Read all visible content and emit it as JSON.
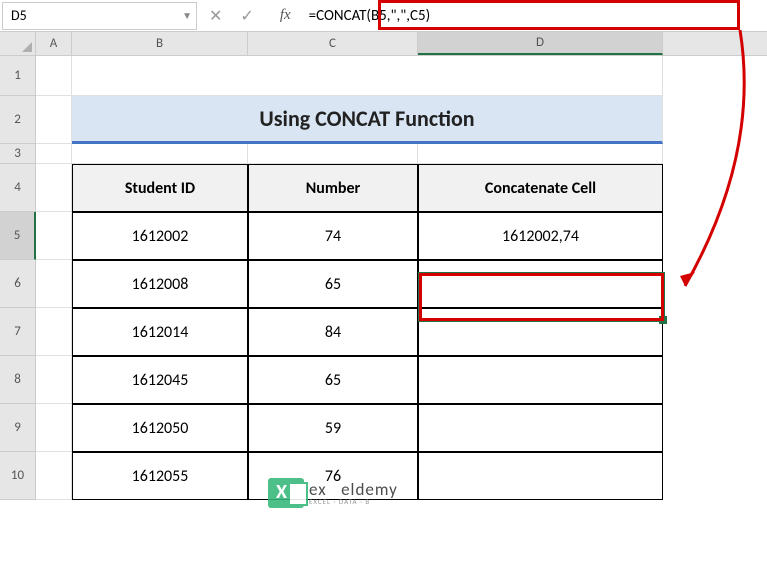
{
  "name_box": "D5",
  "formula_bar": "=CONCAT(B5,\",\",C5)",
  "columns": [
    "A",
    "B",
    "C",
    "D"
  ],
  "rows": [
    "1",
    "2",
    "3",
    "4",
    "5",
    "6",
    "7",
    "8",
    "9",
    "10"
  ],
  "active_row": "5",
  "active_col": "D",
  "title": "Using CONCAT Function",
  "table": {
    "headers": [
      "Student ID",
      "Number",
      "Concatenate Cell"
    ],
    "rows": [
      {
        "id": "1612002",
        "num": "74",
        "concat": "1612002,74"
      },
      {
        "id": "1612008",
        "num": "65",
        "concat": ""
      },
      {
        "id": "1612014",
        "num": "84",
        "concat": ""
      },
      {
        "id": "1612045",
        "num": "65",
        "concat": ""
      },
      {
        "id": "1612050",
        "num": "59",
        "concat": ""
      },
      {
        "id": "1612055",
        "num": "76",
        "concat": ""
      }
    ]
  },
  "logo": {
    "main": "ex   eldemy",
    "sub": "EXCEL · DATA · B"
  },
  "chart_data": {
    "type": "table",
    "title": "Using CONCAT Function",
    "columns": [
      "Student ID",
      "Number",
      "Concatenate Cell"
    ],
    "rows": [
      [
        "1612002",
        74,
        "1612002,74"
      ],
      [
        "1612008",
        65,
        ""
      ],
      [
        "1612014",
        84,
        ""
      ],
      [
        "1612045",
        65,
        ""
      ],
      [
        "1612050",
        59,
        ""
      ],
      [
        "1612055",
        76,
        ""
      ]
    ],
    "formula": "=CONCAT(B5,\",\",C5)",
    "active_cell": "D5"
  }
}
